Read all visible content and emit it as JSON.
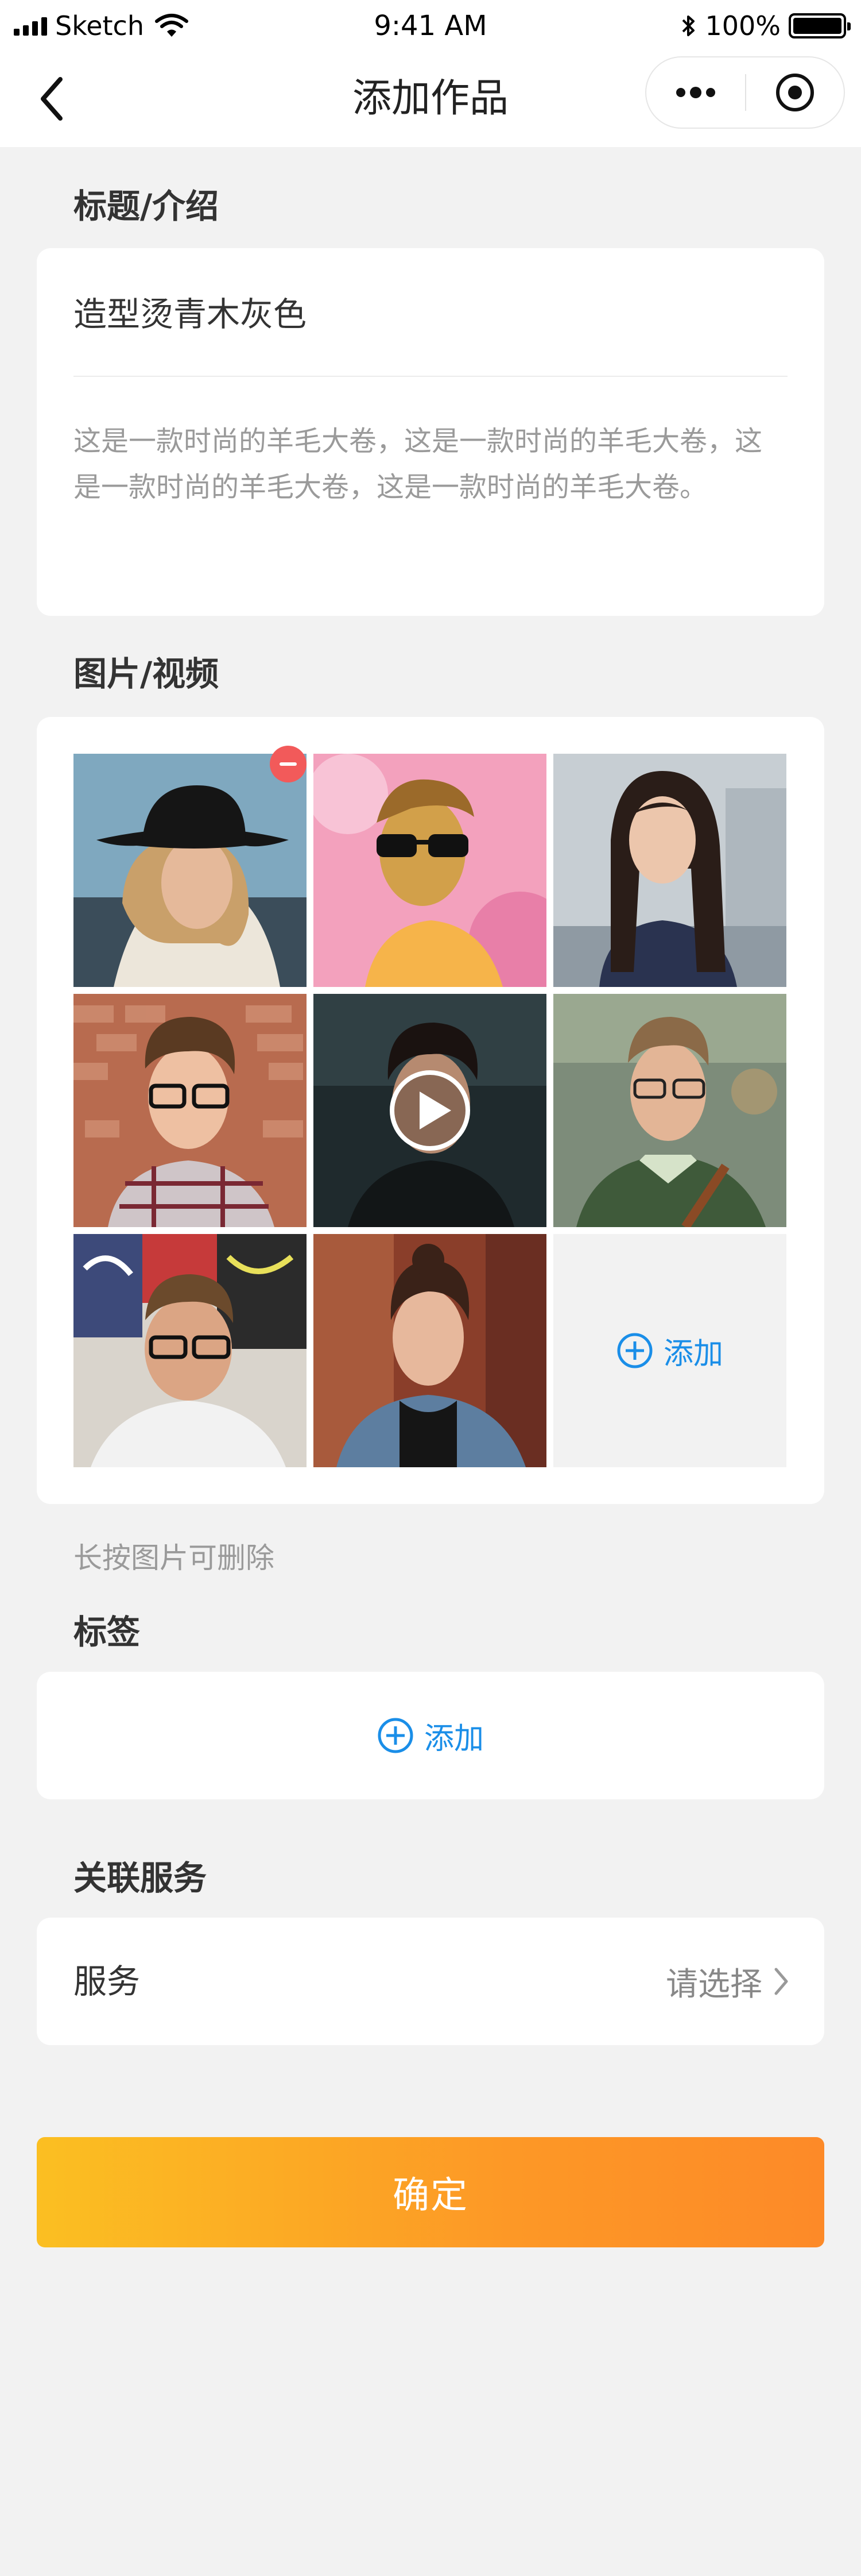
{
  "status_bar": {
    "carrier": "Sketch",
    "time": "9:41 AM",
    "battery": "100%"
  },
  "nav": {
    "title": "添加作品",
    "back_icon": "chevron-left-icon",
    "more_icon": "more-dots-icon",
    "close_icon": "target-circle-icon"
  },
  "sections": {
    "title_intro_label": "标题/介绍",
    "media_label": "图片/视频",
    "tags_label": "标签",
    "service_label": "关联服务"
  },
  "work": {
    "title": "造型烫青木灰色",
    "intro": "这是一款时尚的羊毛大卷，这是一款时尚的羊毛大卷，这是一款时尚的羊毛大卷，这是一款时尚的羊毛大卷。"
  },
  "media": {
    "items": [
      {
        "type": "photo",
        "subject": "woman-black-hat",
        "removable": true
      },
      {
        "type": "photo",
        "subject": "man-sunglasses-pink"
      },
      {
        "type": "photo",
        "subject": "woman-long-hair"
      },
      {
        "type": "photo",
        "subject": "man-glasses-plaid"
      },
      {
        "type": "video",
        "subject": "man-dark-background"
      },
      {
        "type": "photo",
        "subject": "man-green-sweater"
      },
      {
        "type": "photo",
        "subject": "man-glasses-graffiti"
      },
      {
        "type": "photo",
        "subject": "woman-denim-jacket"
      }
    ],
    "add_label": "添加",
    "hint": "长按图片可删除"
  },
  "tags": {
    "add_label": "添加"
  },
  "service": {
    "label": "服务",
    "value": "请选择"
  },
  "confirm_label": "确定",
  "colors": {
    "accent_blue": "#1a8ee8",
    "confirm_start": "#fbbf22",
    "confirm_end": "#fd8a28",
    "remove_red": "#f25a5a",
    "background": "#f2f2f2"
  }
}
